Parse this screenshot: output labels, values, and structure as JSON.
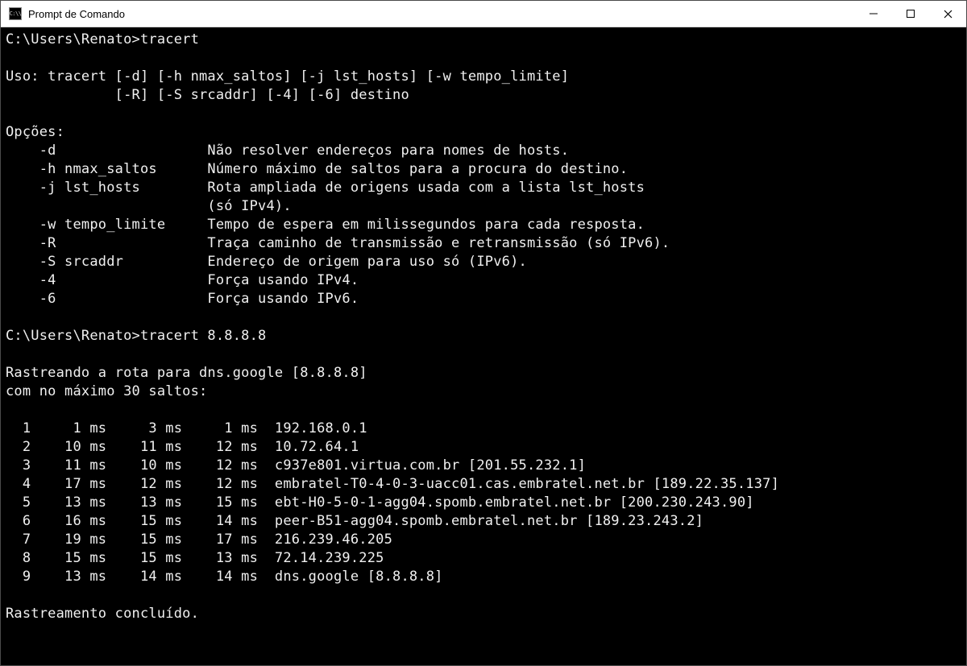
{
  "window": {
    "title": "Prompt de Comando"
  },
  "terminal": {
    "prompt1": "C:\\Users\\Renato>tracert",
    "usage1": "Uso: tracert [-d] [-h nmax_saltos] [-j lst_hosts] [-w tempo_limite]",
    "usage2": "             [-R] [-S srcaddr] [-4] [-6] destino",
    "options_header": "Opções:",
    "opt_d": "    -d                  Não resolver endereços para nomes de hosts.",
    "opt_h": "    -h nmax_saltos      Número máximo de saltos para a procura do destino.",
    "opt_j1": "    -j lst_hosts        Rota ampliada de origens usada com a lista lst_hosts",
    "opt_j2": "                        (só IPv4).",
    "opt_w": "    -w tempo_limite     Tempo de espera em milissegundos para cada resposta.",
    "opt_R": "    -R                  Traça caminho de transmissão e retransmissão (só IPv6).",
    "opt_S": "    -S srcaddr          Endereço de origem para uso só (IPv6).",
    "opt_4": "    -4                  Força usando IPv4.",
    "opt_6": "    -6                  Força usando IPv6.",
    "prompt2": "C:\\Users\\Renato>tracert 8.8.8.8",
    "trace_head1": "Rastreando a rota para dns.google [8.8.8.8]",
    "trace_head2": "com no máximo 30 saltos:",
    "hop1": "  1     1 ms     3 ms     1 ms  192.168.0.1",
    "hop2": "  2    10 ms    11 ms    12 ms  10.72.64.1",
    "hop3": "  3    11 ms    10 ms    12 ms  c937e801.virtua.com.br [201.55.232.1]",
    "hop4": "  4    17 ms    12 ms    12 ms  embratel-T0-4-0-3-uacc01.cas.embratel.net.br [189.22.35.137]",
    "hop5": "  5    13 ms    13 ms    15 ms  ebt-H0-5-0-1-agg04.spomb.embratel.net.br [200.230.243.90]",
    "hop6": "  6    16 ms    15 ms    14 ms  peer-B51-agg04.spomb.embratel.net.br [189.23.243.2]",
    "hop7": "  7    19 ms    15 ms    17 ms  216.239.46.205",
    "hop8": "  8    15 ms    15 ms    13 ms  72.14.239.225",
    "hop9": "  9    13 ms    14 ms    14 ms  dns.google [8.8.8.8]",
    "done": "Rastreamento concluído."
  }
}
